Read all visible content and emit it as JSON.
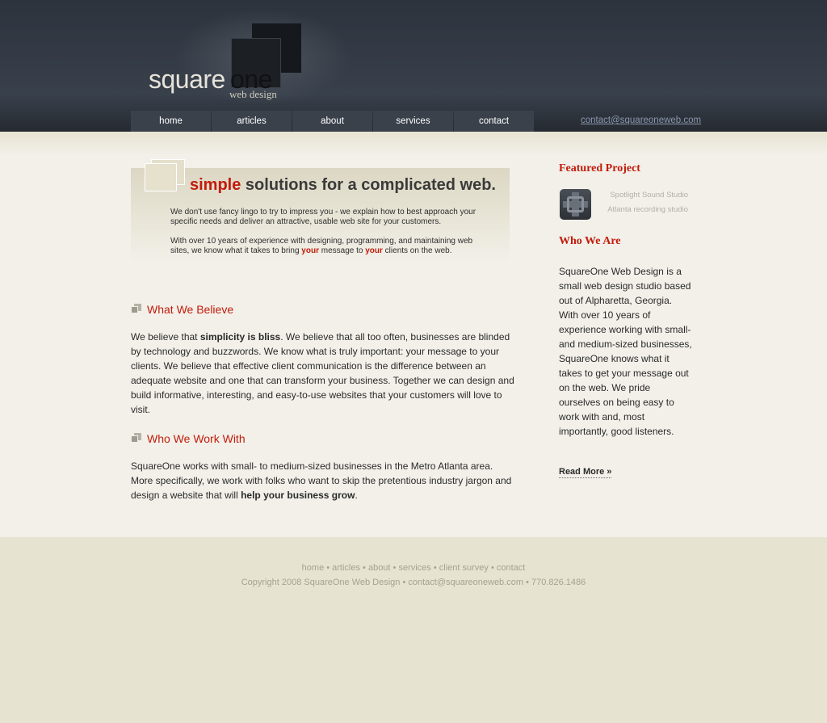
{
  "header": {
    "logo": {
      "word1": "square",
      "word2": "one",
      "tagline": "web design"
    },
    "nav": [
      {
        "label": "home"
      },
      {
        "label": "articles"
      },
      {
        "label": "about"
      },
      {
        "label": "services"
      },
      {
        "label": "contact"
      }
    ],
    "email": "contact@squareoneweb.com"
  },
  "intro": {
    "title_highlight": "simple",
    "title_rest": " solutions for a complicated web.",
    "p1": "We don't use fancy lingo to try to impress you - we explain how to best approach your specific needs and deliver an attractive, usable web site for your customers.",
    "p2_a": "With over 10 years of experience with designing, programming, and maintaining web sites, we know what it takes to bring ",
    "p2_your1": "your",
    "p2_b": " message to ",
    "p2_your2": "your",
    "p2_c": " clients on the web."
  },
  "sections": {
    "believe": {
      "title": "What We Believe",
      "t1": "We believe that ",
      "b1": "simplicity is bliss",
      "t2": ". We believe that all too often, businesses are blinded by technology and buzzwords. We know what is truly important: your message to your clients. We believe that effective client communication is the difference between an adequate website and one that can transform your business. Together we can design and build informative, interesting, and easy-to-use websites that your customers will love to visit."
    },
    "work": {
      "title": "Who We Work With",
      "t1": "SquareOne works with small- to medium-sized businesses in the Metro Atlanta area. More specifically, we work with folks who want to skip the pretentious industry jargon and design a website that will ",
      "b1": "help your business grow",
      "t2": "."
    }
  },
  "sidebar": {
    "featured_title": "Featured Project",
    "featured_name": "Spotlight Sound Studio",
    "featured_desc": "Atlanta recording studio",
    "who_title": "Who We Are",
    "who_body": "SquareOne Web Design is a small web design studio based out of Alpharetta, Georgia. With over 10 years of experience working with small- and medium-sized businesses, SquareOne knows what it takes to get your message out on the web. We pride ourselves on being easy to work with and, most importantly, good listeners.",
    "read_more": "Read More »"
  },
  "footer": {
    "links": "home • articles • about • services • client survey • contact",
    "copyright": "Copyright 2008 SquareOne Web Design • contact@squareoneweb.com • 770.826.1486"
  },
  "colors": {
    "accent": "#c21b0b",
    "header_bg": "#353c46",
    "main_bg": "#f2f0e9",
    "footer_bg": "#e6e3d0"
  }
}
